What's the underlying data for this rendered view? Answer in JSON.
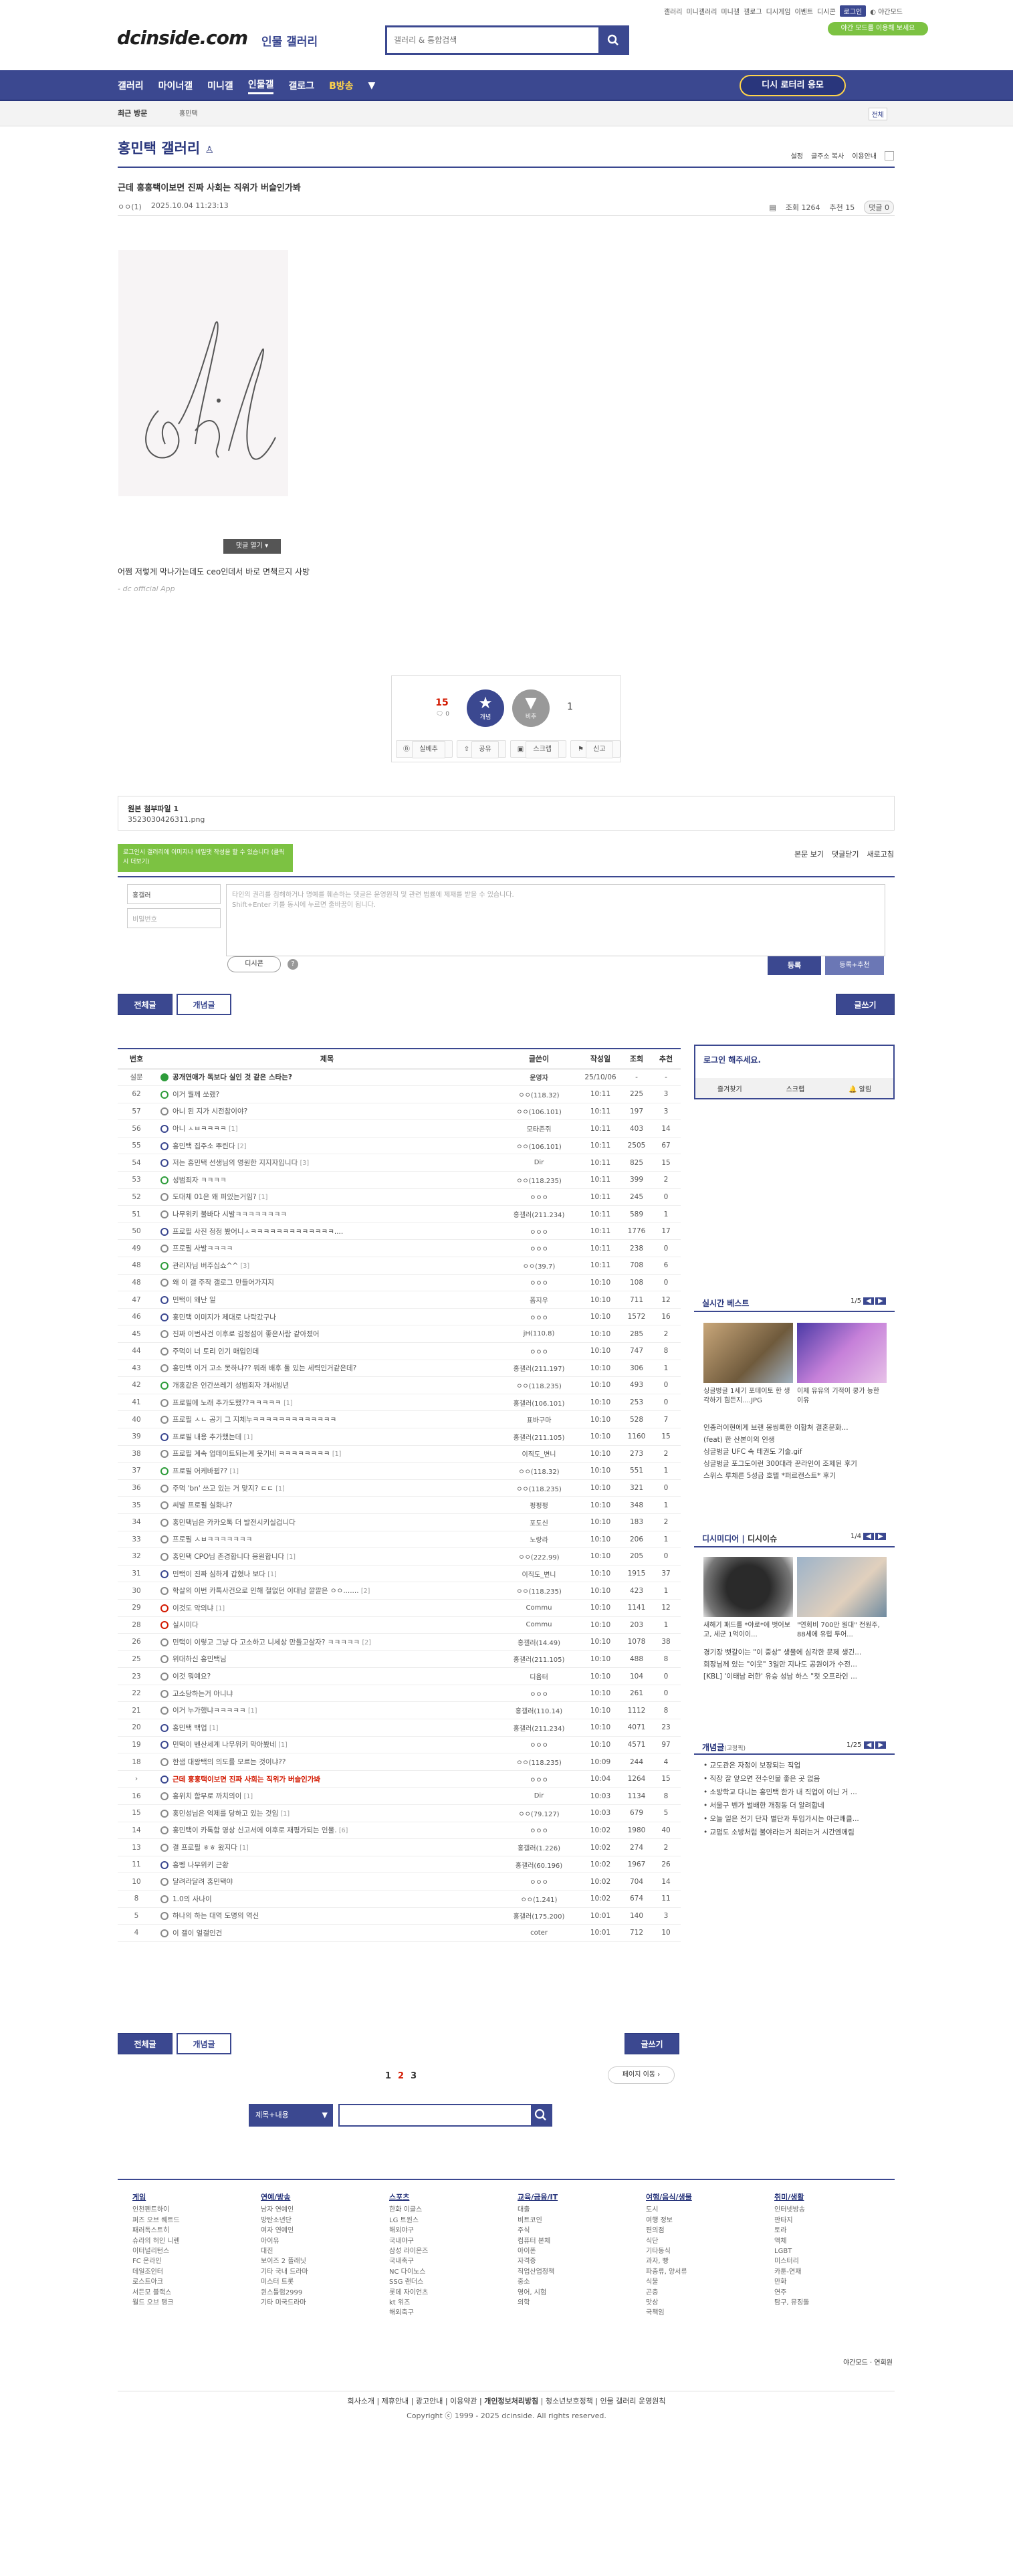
{
  "topnav": {
    "items": [
      "갤러리",
      "미니갤러리",
      "미니갤",
      "갤로그",
      "디시게임",
      "이벤트",
      "디시콘"
    ],
    "login": "로그인",
    "darkmode": "야간모드",
    "darkbadge": "야간 모드를 이용해 보세요"
  },
  "logo": "dcinside.com",
  "logo_sub": "인물 갤러리",
  "search": {
    "placeholder": "갤러리 & 통합검색"
  },
  "gnb": {
    "items": [
      "갤러리",
      "마이너갤",
      "미니갤",
      "인물갤",
      "갤로그",
      "이벤트",
      "NFT",
      "B방송"
    ],
    "visit": "디시 로터리 응모"
  },
  "subnav": {
    "recent": "최근 방문",
    "tag": "홍민택",
    "all": "전체"
  },
  "gallery": {
    "title": "홍민택 갤러리",
    "tools": [
      "설정",
      "글주소 복사",
      "이용안내"
    ]
  },
  "post": {
    "subject": "근데 홍홍택이보면 진짜 사회는 직위가 버슬인가봐",
    "author": "ㅇㅇ(1)",
    "date": "2025.10.04 11:23:13",
    "views": "조회 1264",
    "rec": "추천 15",
    "cmt": "댓글 0",
    "close": "댓글 열기",
    "body": "어쩜 저렇게 막나가는데도 ceo인데서 바로 면책르지 사방",
    "app": "- dc official App"
  },
  "vote": {
    "up": "15",
    "fixed": "고정 0",
    "up_label": "개념",
    "down_label": "비추",
    "down": "1",
    "buttons": [
      "실베추",
      "공유",
      "스크랩",
      "신고"
    ]
  },
  "attach": {
    "title": "원본 첨부파일 1",
    "file": "3523030426311.png"
  },
  "tip": "로그인시 갤러리에 이미지나 비밀댓 작성을 할 수 있습니다 (클릭 시 더보기)",
  "cmtbar": [
    "본문 보기",
    "댓글닫기",
    "새로고침"
  ],
  "cmtform": {
    "nick": "홍갤러",
    "pw": "비밀번호",
    "ta": "타인의 권리를 침해하거나 명예를 훼손하는 댓글은 운영원칙 및 관련 법률에 제재를 받을 수 있습니다.\nShift+Enter 키를 동시에 누르면 줄바꿈이 됩니다.",
    "dccon": "디시콘",
    "reg": "등록",
    "reg2": "등록+추천"
  },
  "btns": {
    "all": "전체글",
    "concept": "개념글",
    "write": "글쓰기"
  },
  "list": {
    "headers": [
      "번호",
      "제목",
      "글쓴이",
      "작성일",
      "조회",
      "추천"
    ],
    "rows": [
      {
        "n": "설문",
        "t": "공개연애가 독보다 실인 것 같은 스타는?",
        "c": "",
        "w": "운영자",
        "d": "25/10/06",
        "v": "-",
        "r": "-",
        "ic": "notice",
        "b": true
      },
      {
        "n": "62",
        "t": "이거 뭘께 쏘랬?",
        "c": "",
        "w": "ㅇㅇ(118.32)",
        "d": "10:11",
        "v": "225",
        "r": "3",
        "ic": "hot"
      },
      {
        "n": "57",
        "t": "아니 된 지가 시전참이야?",
        "c": "",
        "w": "ㅇㅇ(106.101)",
        "d": "10:11",
        "v": "197",
        "r": "3",
        "ic": "txt"
      },
      {
        "n": "56",
        "t": "아니 ㅅㅂㅋㅋㅋㅋ",
        "c": "[1]",
        "w": "모타존쥐",
        "d": "10:11",
        "v": "403",
        "r": "14",
        "ic": "img"
      },
      {
        "n": "55",
        "t": "홍민택 집주소 뿌린다",
        "c": "[2]",
        "w": "ㅇㅇ(106.101)",
        "d": "10:11",
        "v": "2505",
        "r": "67",
        "ic": "img"
      },
      {
        "n": "54",
        "t": "저는 홍민택 선생님의 영원한 지지자입니다",
        "c": "[3]",
        "w": "Dir",
        "d": "10:11",
        "v": "825",
        "r": "15",
        "ic": "img"
      },
      {
        "n": "53",
        "t": "성범죄자 ㅋㅋㅋㅋ",
        "c": "",
        "w": "ㅇㅇ(118.235)",
        "d": "10:11",
        "v": "399",
        "r": "2",
        "ic": "hot"
      },
      {
        "n": "52",
        "t": "도대체 01은 왜 퍼있는거임?",
        "c": "[1]",
        "w": "ㅇㅇㅇ",
        "d": "10:11",
        "v": "245",
        "r": "0",
        "ic": "txt"
      },
      {
        "n": "51",
        "t": "나무위키 불바다 시발ㅋㅋㅋㅋㅋㅋㅋㅋ",
        "c": "",
        "w": "홍갤러(211.234)",
        "d": "10:11",
        "v": "589",
        "r": "1",
        "ic": "txt"
      },
      {
        "n": "50",
        "t": "프로필 사진 정정 봤어니ㅅㅋㅋㅋㅋㅋㅋㅋㅋㅋㅋㅋㅋㅋ....",
        "c": "",
        "w": "ㅇㅇㅇ",
        "d": "10:11",
        "v": "1776",
        "r": "17",
        "ic": "img"
      },
      {
        "n": "49",
        "t": "프로필 사발ㅋㅋㅋㅋ",
        "c": "",
        "w": "ㅇㅇㅇ",
        "d": "10:11",
        "v": "238",
        "r": "0",
        "ic": "txt"
      },
      {
        "n": "48",
        "t": "관리자님 버주십쇼^^",
        "c": "[3]",
        "w": "ㅇㅇ(39.7)",
        "d": "10:11",
        "v": "708",
        "r": "6",
        "ic": "hot"
      },
      {
        "n": "48",
        "t": "왜 이 갤 주작 갤로그 만들어가지지",
        "c": "",
        "w": "ㅇㅇㅇ",
        "d": "10:10",
        "v": "108",
        "r": "0",
        "ic": "txt"
      },
      {
        "n": "47",
        "t": "민택이 왜난 일",
        "c": "",
        "w": "폼지우",
        "d": "10:10",
        "v": "711",
        "r": "12",
        "ic": "img"
      },
      {
        "n": "46",
        "t": "홍민택 이미지가 제대로 나락갔구나",
        "c": "",
        "w": "ㅇㅇㅇ",
        "d": "10:10",
        "v": "1572",
        "r": "16",
        "ic": "img"
      },
      {
        "n": "45",
        "t": "진짜 이번사건 이후로 김정섬이 좋은사람 같아졌어",
        "c": "",
        "w": "jH(110.8)",
        "d": "10:10",
        "v": "285",
        "r": "2",
        "ic": "txt"
      },
      {
        "n": "44",
        "t": "주먹이 너 토리 인기 매입인데",
        "c": "",
        "w": "ㅇㅇㅇ",
        "d": "10:10",
        "v": "747",
        "r": "8",
        "ic": "txt"
      },
      {
        "n": "43",
        "t": "홍민택 이거 고소 못하냐?? 뭐래 배후 둘 있는 세력인거같은데?",
        "c": "",
        "w": "홍갤러(211.197)",
        "d": "10:10",
        "v": "306",
        "r": "1",
        "ic": "txt"
      },
      {
        "n": "42",
        "t": "개홍같은 인간쓰레기 성범죄자 개새빙년",
        "c": "",
        "w": "ㅇㅇ(118.235)",
        "d": "10:10",
        "v": "493",
        "r": "0",
        "ic": "hot"
      },
      {
        "n": "41",
        "t": "프로필에 노래 추가도했??ㅋㅋㅋㅋㅋ",
        "c": "[1]",
        "w": "홍갤러(106.101)",
        "d": "10:10",
        "v": "253",
        "r": "0",
        "ic": "txt"
      },
      {
        "n": "40",
        "t": "프로필 ㅅㄴ 공기 그 지체누ㅋㅋㅋㅋㅋㅋㅋㅋㅋㅋㅋㅋㅋ",
        "c": "",
        "w": "표바구마",
        "d": "10:10",
        "v": "528",
        "r": "7",
        "ic": "txt"
      },
      {
        "n": "39",
        "t": "프로필 내용 추가했는데",
        "c": "[1]",
        "w": "홍갤러(211.105)",
        "d": "10:10",
        "v": "1160",
        "r": "15",
        "ic": "img"
      },
      {
        "n": "38",
        "t": "프로필 계속 업데이트되는게 웃기네 ㅋㅋㅋㅋㅋㅋㅋㅋ",
        "c": "[1]",
        "w": "이직도_변니",
        "d": "10:10",
        "v": "273",
        "r": "2",
        "ic": "txt"
      },
      {
        "n": "37",
        "t": "프로필 어케바뀜??",
        "c": "[1]",
        "w": "ㅇㅇ(118.32)",
        "d": "10:10",
        "v": "551",
        "r": "1",
        "ic": "hot"
      },
      {
        "n": "36",
        "t": "주먹 'bn' 쓰고 있는 거 맞지? ㄷㄷ",
        "c": "[1]",
        "w": "ㅇㅇ(118.235)",
        "d": "10:10",
        "v": "321",
        "r": "0",
        "ic": "txt"
      },
      {
        "n": "35",
        "t": "씨발 프로필 실화냐?",
        "c": "",
        "w": "펑펑펑",
        "d": "10:10",
        "v": "348",
        "r": "1",
        "ic": "txt"
      },
      {
        "n": "34",
        "t": "홍민택님은 카카오톡 더 발전시키실겁니다",
        "c": "",
        "w": "포도신",
        "d": "10:10",
        "v": "183",
        "r": "2",
        "ic": "txt"
      },
      {
        "n": "33",
        "t": "프로필 ㅅㅂㅋㅋㅋㅋㅋㅋㅋ",
        "c": "",
        "w": "노랑라",
        "d": "10:10",
        "v": "206",
        "r": "1",
        "ic": "txt"
      },
      {
        "n": "32",
        "t": "홍민택 CPO님 존경합니다 응원합니다",
        "c": "[1]",
        "w": "ㅇㅇ(222.99)",
        "d": "10:10",
        "v": "205",
        "r": "0",
        "ic": "txt"
      },
      {
        "n": "31",
        "t": "민택이 진짜 심하게 갑혔나 보다",
        "c": "[1]",
        "w": "이직도_변니",
        "d": "10:10",
        "v": "1915",
        "r": "37",
        "ic": "img"
      },
      {
        "n": "30",
        "t": "학살의 이번 카톡사건으로 인해 철없던 이대남 깔깔은 ㅇㅇ.......",
        "c": "[2]",
        "w": "ㅇㅇ(118.235)",
        "d": "10:10",
        "v": "423",
        "r": "1",
        "ic": "txt"
      },
      {
        "n": "29",
        "t": "이것도 악의냐",
        "c": "[1]",
        "w": "Commu",
        "d": "10:10",
        "v": "1141",
        "r": "12",
        "ic": "rec"
      },
      {
        "n": "28",
        "t": "실시미다",
        "c": "",
        "w": "Commu",
        "d": "10:10",
        "v": "203",
        "r": "1",
        "ic": "rec"
      },
      {
        "n": "26",
        "t": "민택이 이렇고 그냥 다 고소하고 니세상 만들고살자? ㅋㅋㅋㅋㅋ",
        "c": "[2]",
        "w": "홍갤러(14.49)",
        "d": "10:10",
        "v": "1078",
        "r": "38",
        "ic": "txt"
      },
      {
        "n": "25",
        "t": "위대하신 홍민택님",
        "c": "",
        "w": "홍갤러(211.105)",
        "d": "10:10",
        "v": "488",
        "r": "8",
        "ic": "txt"
      },
      {
        "n": "23",
        "t": "이것 뭐예요?",
        "c": "",
        "w": "디윰터",
        "d": "10:10",
        "v": "104",
        "r": "0",
        "ic": "txt"
      },
      {
        "n": "22",
        "t": "고소당하는거 아니냐",
        "c": "",
        "w": "ㅇㅇㅇ",
        "d": "10:10",
        "v": "261",
        "r": "0",
        "ic": "txt"
      },
      {
        "n": "21",
        "t": "이거 누가했냐ㅋㅋㅋㅋㅋ",
        "c": "[1]",
        "w": "홍갤러(110.14)",
        "d": "10:10",
        "v": "1112",
        "r": "8",
        "ic": "txt"
      },
      {
        "n": "20",
        "t": "홍민택 백업",
        "c": "[1]",
        "w": "홍갤러(211.234)",
        "d": "10:10",
        "v": "4071",
        "r": "23",
        "ic": "img"
      },
      {
        "n": "19",
        "t": "민택이 벤산세계 나무위키 막아봤네",
        "c": "[1]",
        "w": "ㅇㅇㅇ",
        "d": "10:10",
        "v": "4571",
        "r": "97",
        "ic": "img"
      },
      {
        "n": "18",
        "t": "한샘 대왕택의 의도를 모르는 것이냐??",
        "c": "",
        "w": "ㅇㅇ(118.235)",
        "d": "10:09",
        "v": "244",
        "r": "4",
        "ic": "txt"
      },
      {
        "n": "›",
        "t": "근데 홍홍택이보면 진짜 사회는 직위가 버슬인가봐",
        "c": "",
        "w": "ㅇㅇㅇ",
        "d": "10:04",
        "v": "1264",
        "r": "15",
        "ic": "img",
        "cur": true
      },
      {
        "n": "16",
        "t": "홍위치 함무로 까치의이",
        "c": "[1]",
        "w": "Dir",
        "d": "10:03",
        "v": "1134",
        "r": "8",
        "ic": "txt"
      },
      {
        "n": "15",
        "t": "홍민성님은 억제를 당하고 있는 것임",
        "c": "[1]",
        "w": "ㅇㅇ(79.127)",
        "d": "10:03",
        "v": "679",
        "r": "5",
        "ic": "txt"
      },
      {
        "n": "14",
        "t": "홍민택이 카톡함 영상 신고서에 이후로 재평가되는 인물.",
        "c": "[6]",
        "w": "ㅇㅇㅇ",
        "d": "10:02",
        "v": "1980",
        "r": "40",
        "ic": "txt"
      },
      {
        "n": "13",
        "t": "결 프로필 ㅎㅎ 왔지다",
        "c": "[1]",
        "w": "홍갤러(1.226)",
        "d": "10:02",
        "v": "274",
        "r": "2",
        "ic": "txt"
      },
      {
        "n": "11",
        "t": "홍벵 나무위키 근황",
        "c": "",
        "w": "홍갤러(60.196)",
        "d": "10:02",
        "v": "1967",
        "r": "26",
        "ic": "img"
      },
      {
        "n": "10",
        "t": "달려라달려 홍민택야",
        "c": "",
        "w": "ㅇㅇㅇ",
        "d": "10:02",
        "v": "704",
        "r": "14",
        "ic": "txt"
      },
      {
        "n": "8",
        "t": "1.0의 사나이",
        "c": "",
        "w": "ㅇㅇ(1.241)",
        "d": "10:02",
        "v": "674",
        "r": "11",
        "ic": "txt"
      },
      {
        "n": "5",
        "t": "하나의 하는 대역 도명의 역신",
        "c": "",
        "w": "홍갤러(175.200)",
        "d": "10:01",
        "v": "140",
        "r": "3",
        "ic": "txt"
      },
      {
        "n": "4",
        "t": "이 갤이 얼갤인건",
        "c": "",
        "w": "coter",
        "d": "10:01",
        "v": "712",
        "r": "10",
        "ic": "txt"
      }
    ]
  },
  "side": {
    "login": "로그인 해주세요.",
    "login_links": [
      "즐겨찾기",
      "스크랩",
      "알림"
    ],
    "best_title": "실시간 베스트",
    "best_page": "1/5",
    "best_caps": [
      "싱글벙글 1세기 포테이토 한 생각하기 힘든지....JPG",
      "이제 유유의 기적이 쿵가 능한 이유"
    ],
    "best_list": [
      "인종러이현에게 브랜 몽씽록한 이합쳐 결혼문화...",
      "(feat) 한 산본이의 인생",
      "싱글벙글 UFC 속 테권도 기술.gif",
      "싱글벙글 포그도이런 300대라 꾼라인이 조제된 후기",
      "스위스 루체른 5성급 호텔 *퍼르캔스트* 후기"
    ],
    "dcissue_title": "디시미디어",
    "dcissue_sub": "디시이슈",
    "dcissue_page": "1/4",
    "dcissue_caps": [
      "새해기 패드를 *야로*에 벗어보고, 세군 1억이이...",
      "\"연회비 700만 원대\" 전원주, 88세에 유럽 투어..."
    ],
    "dcissue_list": [
      "경기장 뻣갈이는 \"이 중상\" 생물에 심각한 문제 생긴...",
      "회장님께 있는 \"이웃\" 3일만 지나도 공원이가 수전...",
      "[KBL] '이태남 러한' 유승 성남 하스 \"첫 오프라인 ..."
    ],
    "gn_title": "개념글",
    "gn_sub": "(고정픽)",
    "gn_page": "1/25",
    "gn_list": [
      "교도관은 자정이 보장되는 직업",
      "직장 잘 앞으면 전수인물 좋은 곳 없음",
      "소방학교 다니는 홍민택 한가 내 직업이 이닌 거 ...",
      "서울구 벤가 벌배한 개정동 더 알려합네",
      "오늘 일은 전기 단자 별단과 투입가시는 아근쾌클...",
      "교펌도 소방처럼 불야라는거 최러는거 시간엔께림"
    ]
  },
  "pagination": [
    "1",
    "2",
    "3"
  ],
  "next_search": "페이지 이동",
  "bsearch": {
    "select": "제목+내용"
  },
  "footer": {
    "cols": [
      {
        "t": "게임",
        "items": [
          "인천펜트하이",
          "퍼즈 오브 퀘트드",
          "패러독스트히",
          "슈라의 허인 니렌",
          "이터널리턴스",
          "FC 온라인",
          "데일조인터",
          "로스트아크",
          "서든모 블랙스",
          "월드 오브 탱크"
        ]
      },
      {
        "t": "연예/방송",
        "items": [
          "남자 연예인",
          "방탄소년단",
          "여자 연예인",
          "아이유",
          "대진",
          "보이즈 2 플래닛",
          "기타 국내 드라마",
          "미스터 트롯",
          "윈스틀럼2999",
          "기타 미국드라마"
        ]
      },
      {
        "t": "스포츠",
        "items": [
          "한화 이글스",
          "LG 트윈스",
          "해외야구",
          "국내야구",
          "삼성 라이온즈",
          "국내축구",
          "NC 다이노스",
          "SSG 랜더스",
          "롯데 자이언츠",
          "kt 위즈",
          "해외축구"
        ]
      },
      {
        "t": "교육/금융/IT",
        "items": [
          "대출",
          "비트코인",
          "주식",
          "컴퓨터 본체",
          "아이폰",
          "자격증",
          "직업산업정책",
          "중소",
          "영어, 시험",
          "의학"
        ]
      },
      {
        "t": "여행/음식/생물",
        "items": [
          "도시",
          "여행 정보",
          "편의점",
          "식단",
          "기타동식",
          "과자, 빵",
          "파충류, 양서류",
          "식물",
          "곤충",
          "맛상",
          "국책임"
        ]
      },
      {
        "t": "취미/생활",
        "items": [
          "인터넷방송",
          "판타지",
          "토라",
          "액체",
          "LGBT",
          "미스터리",
          "카툰-연재",
          "만화",
          "연주",
          "탐구, 뮤징돌"
        ]
      }
    ]
  },
  "theme": "야간모드 · 연회원",
  "footlinks": [
    "회사소개",
    "제휴안내",
    "광고안내",
    "이용약관",
    "개인정보처리방침",
    "청소년보호정책",
    "인물 갤러리 운영원칙"
  ],
  "copyright": "Copyright ⓒ 1999 - 2025 dcinside. All rights reserved."
}
